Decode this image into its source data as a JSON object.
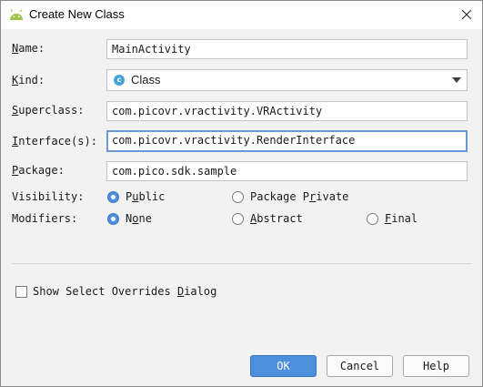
{
  "window": {
    "title": "Create New Class",
    "icon": "android-icon",
    "close_icon": "close-icon"
  },
  "form": {
    "name": {
      "label_hot": "N",
      "label_rest": "ame:",
      "value": "MainActivity"
    },
    "kind": {
      "label_hot": "K",
      "label_rest": "ind:",
      "value": "Class",
      "value_icon_glyph": "c",
      "value_icon": "class-icon"
    },
    "superclass": {
      "label_hot": "S",
      "label_rest": "uperclass:",
      "value": "com.picovr.vractivity.VRActivity"
    },
    "interface": {
      "label_hot": "I",
      "label_rest": "nterface(s):",
      "value": "com.picovr.vractivity.RenderInterface"
    },
    "package": {
      "label_hot": "P",
      "label_rest": "ackage:",
      "value": "com.pico.sdk.sample"
    }
  },
  "visibility": {
    "label": "Visibility:",
    "options": [
      {
        "pre": "P",
        "hot": "u",
        "post": "blic",
        "selected": true
      },
      {
        "pre": "Package P",
        "hot": "r",
        "post": "ivate",
        "selected": false
      }
    ]
  },
  "modifiers": {
    "label": "Modifiers:",
    "options": [
      {
        "pre": "N",
        "hot": "o",
        "post": "ne",
        "selected": true
      },
      {
        "pre": "",
        "hot": "A",
        "post": "bstract",
        "selected": false
      },
      {
        "pre": "",
        "hot": "F",
        "post": "inal",
        "selected": false
      }
    ]
  },
  "overrides": {
    "pre": "Show Select Overrides ",
    "hot": "D",
    "post": "ialog",
    "checked": false
  },
  "buttons": {
    "ok": "OK",
    "cancel": "Cancel",
    "help": "Help"
  },
  "colors": {
    "accent": "#4e8fdb",
    "focus_border": "#6a9ad6",
    "dialog_bg": "#f2f2f2",
    "android_green": "#9fc44a",
    "class_icon": "#49a2d6"
  }
}
